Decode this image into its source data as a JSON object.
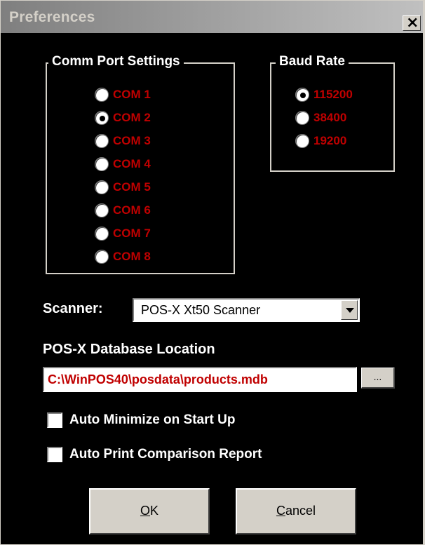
{
  "window": {
    "title": "Preferences",
    "close_label": "×"
  },
  "comm_port": {
    "title": "Comm Port Settings",
    "options": [
      "COM 1",
      "COM 2",
      "COM 3",
      "COM 4",
      "COM 5",
      "COM 6",
      "COM 7",
      "COM 8"
    ],
    "selected_index": 1
  },
  "baud_rate": {
    "title": "Baud Rate",
    "options": [
      "115200",
      "38400",
      "19200"
    ],
    "selected_index": 0
  },
  "scanner": {
    "label": "Scanner:",
    "value": "POS-X Xt50 Scanner"
  },
  "database": {
    "label": "POS-X Database Location",
    "value": "C:\\WinPOS40\\posdata\\products.mdb",
    "browse_label": "..."
  },
  "options": {
    "auto_minimize": {
      "label": "Auto Minimize on Start Up",
      "checked": false
    },
    "auto_print": {
      "label": "Auto Print Comparison Report",
      "checked": false
    }
  },
  "buttons": {
    "ok": {
      "mnemonic": "O",
      "rest": "K"
    },
    "cancel": {
      "mnemonic": "C",
      "rest": "ancel"
    }
  },
  "colors": {
    "option_text": "#c00000",
    "background": "#000000",
    "face": "#d4d0c8"
  }
}
